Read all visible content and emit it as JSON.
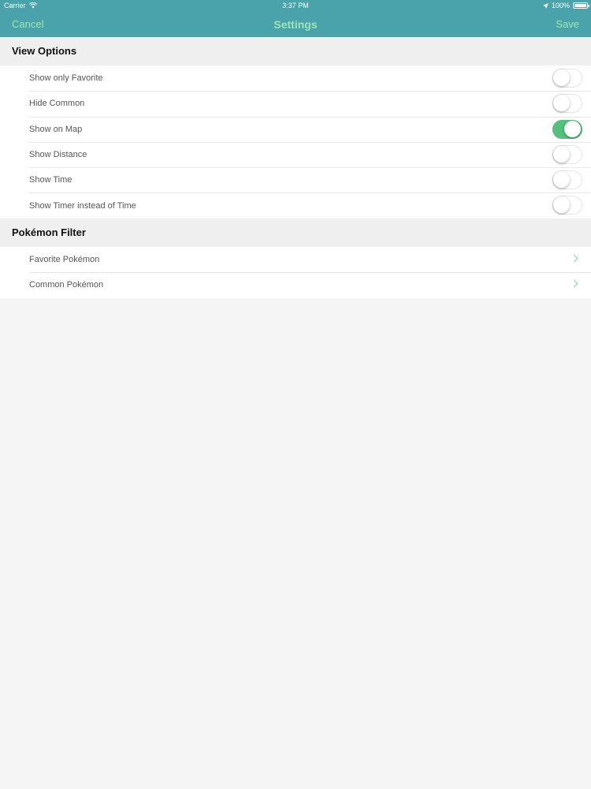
{
  "status": {
    "carrier": "Carrier",
    "time": "3:37 PM",
    "battery": "100%"
  },
  "nav": {
    "cancel": "Cancel",
    "title": "Settings",
    "save": "Save"
  },
  "sections": {
    "view_options": {
      "header": "View Options",
      "rows": [
        {
          "label": "Show only Favorite",
          "on": false
        },
        {
          "label": "Hide Common",
          "on": false
        },
        {
          "label": "Show on Map",
          "on": true
        },
        {
          "label": "Show Distance",
          "on": false
        },
        {
          "label": "Show Time",
          "on": false
        },
        {
          "label": "Show Timer instead of Time",
          "on": false
        }
      ]
    },
    "pokemon_filter": {
      "header": "Pokémon Filter",
      "rows": [
        {
          "label": "Favorite Pokémon"
        },
        {
          "label": "Common Pokémon"
        }
      ]
    }
  },
  "colors": {
    "nav_bg": "#4aa3aa",
    "accent": "#9be7b4",
    "toggle_on": "#53c07c"
  }
}
